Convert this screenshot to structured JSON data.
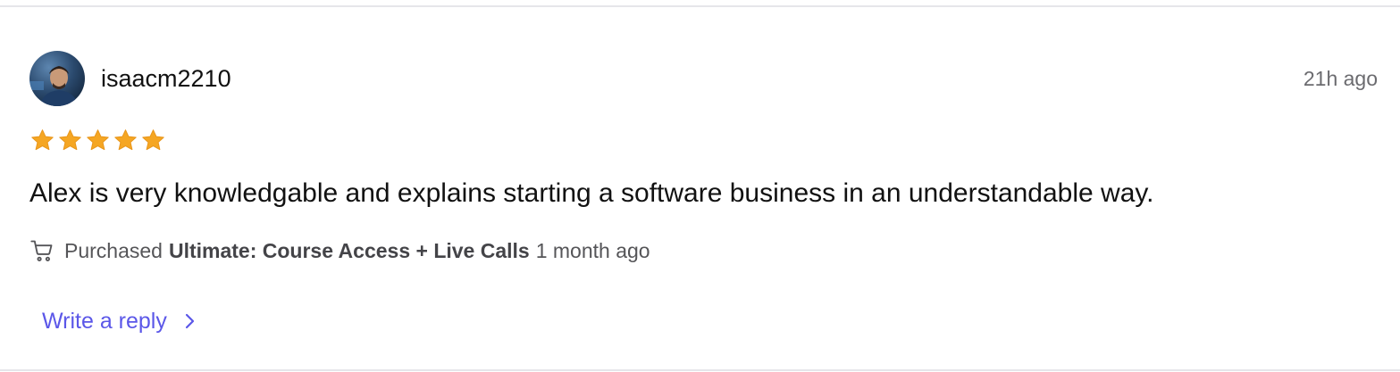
{
  "review": {
    "username": "isaacm2210",
    "time_ago": "21h ago",
    "rating": 5,
    "rating_max": 5,
    "text": "Alex is very knowledgable and explains starting a software business in an understandable way.",
    "purchase": {
      "prefix": "Purchased",
      "product": "Ultimate: Course Access + Live Calls",
      "when": "1 month ago"
    }
  },
  "actions": {
    "reply_label": "Write a reply"
  },
  "icons": {
    "cart": "shopping-cart-icon",
    "star": "star-icon",
    "chevron": "chevron-right-icon"
  },
  "colors": {
    "star": "#f5a623",
    "link": "#5b57e8",
    "divider": "#e6e6ea"
  }
}
